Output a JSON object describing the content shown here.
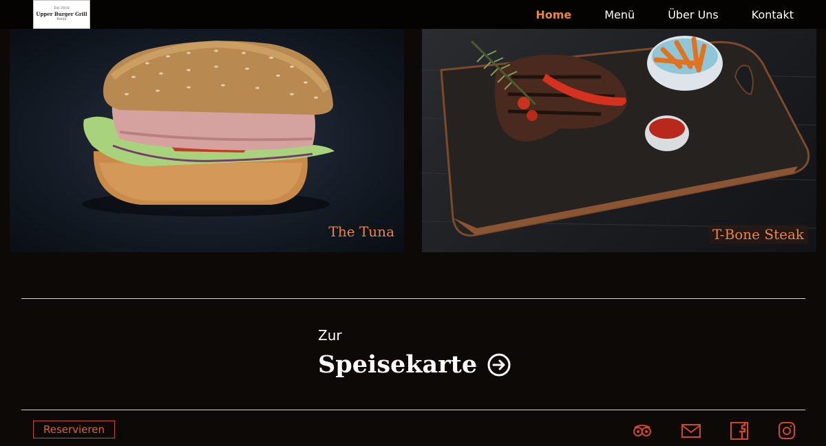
{
  "header": {
    "logo": {
      "est": "Est 2016",
      "name": "Upper Burger Grill",
      "city": "Berlin"
    },
    "nav": [
      {
        "label": "Home",
        "active": true
      },
      {
        "label": "Menü",
        "active": false
      },
      {
        "label": "Über Uns",
        "active": false
      },
      {
        "label": "Kontakt",
        "active": false
      }
    ]
  },
  "cards": [
    {
      "label": "The Tuna",
      "image": "burger"
    },
    {
      "label": "T-Bone Steak",
      "image": "steak-board"
    }
  ],
  "cta": {
    "pre": "Zur",
    "title": "Speisekarte",
    "icon": "arrow-right-circle-icon"
  },
  "footer": {
    "reserve_label": "Reservieren",
    "icons": [
      "tripadvisor-icon",
      "mail-icon",
      "facebook-icon",
      "instagram-icon"
    ]
  },
  "colors": {
    "accent": "#e8873f",
    "background": "#0d0907",
    "reserve": "#c84a1f"
  }
}
